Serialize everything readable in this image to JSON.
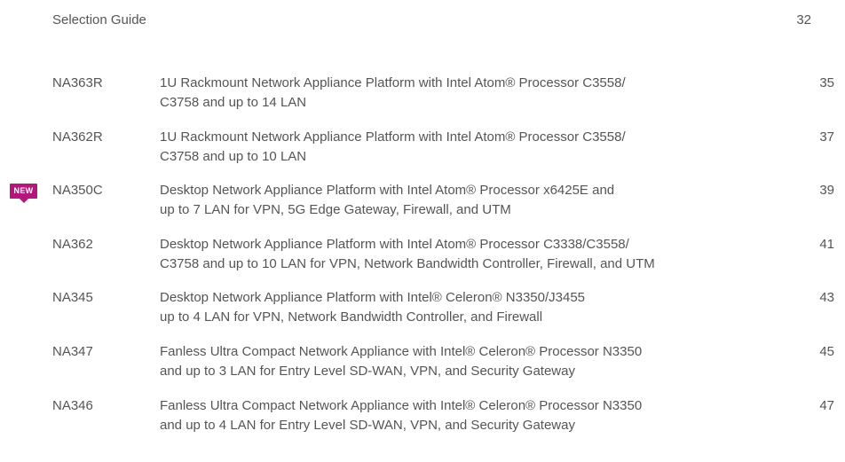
{
  "selection_guide": {
    "label": "Selection Guide",
    "page": "32"
  },
  "badge": {
    "text": "NEW",
    "color": "#b3177b"
  },
  "entries": [
    {
      "model": "NA363R",
      "line1": "1U Rackmount Network Appliance Platform with Intel Atom® Processor C3558/",
      "line2": "C3758 and up to 14 LAN",
      "page": "35"
    },
    {
      "model": "NA362R",
      "line1": "1U Rackmount Network Appliance Platform with Intel Atom® Processor C3558/",
      "line2": "C3758 and up to 10 LAN",
      "page": "37"
    },
    {
      "model": "NA350C",
      "line1": "Desktop Network Appliance Platform with Intel Atom® Processor x6425E and",
      "line2": "up to 7 LAN for VPN, 5G Edge Gateway, Firewall, and UTM",
      "page": "39",
      "is_new": true
    },
    {
      "model": "NA362",
      "line1": "Desktop Network Appliance Platform with Intel Atom® Processor C3338/C3558/",
      "line2": "C3758 and up to 10 LAN for VPN, Network Bandwidth Controller, Firewall, and UTM",
      "page": "41"
    },
    {
      "model": "NA345",
      "line1": "Desktop Network Appliance Platform with Intel® Celeron® N3350/J3455",
      "line2": "up to 4 LAN for VPN, Network Bandwidth Controller, and Firewall",
      "page": "43"
    },
    {
      "model": "NA347",
      "line1": "Fanless Ultra Compact Network Appliance with Intel® Celeron® Processor N3350",
      "line2": "and up to 3 LAN for Entry Level SD-WAN, VPN, and Security Gateway",
      "page": "45"
    },
    {
      "model": "NA346",
      "line1": "Fanless Ultra Compact Network Appliance with Intel® Celeron® Processor N3350",
      "line2": "and up to 4 LAN for Entry Level SD-WAN, VPN, and Security Gateway",
      "page": "47"
    }
  ]
}
